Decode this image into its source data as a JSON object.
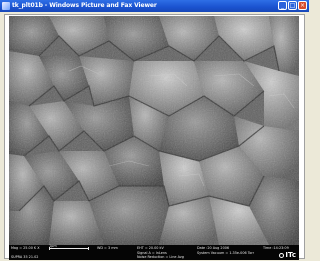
{
  "window": {
    "title": "tk_plt01b - Windows Picture and Fax Viewer"
  },
  "sem_image": {
    "description_icon": "sem-micrograph",
    "databar": {
      "mag": "Mag = 25.00 K X",
      "scale_label": "1μm",
      "wd": "WD = 3 mm",
      "eht": "EHT = 20.00 kV",
      "signal": "Signal A = InLens",
      "noise": "Noise Reduction = Line Avg",
      "date": "Date :20 Aug 2006",
      "vacuum": "System Vacuum = 1.35e-006 Torr",
      "time": "Time :14:23:09",
      "instrument": "SUPRA 35 21.02",
      "logo": "ITc"
    }
  }
}
